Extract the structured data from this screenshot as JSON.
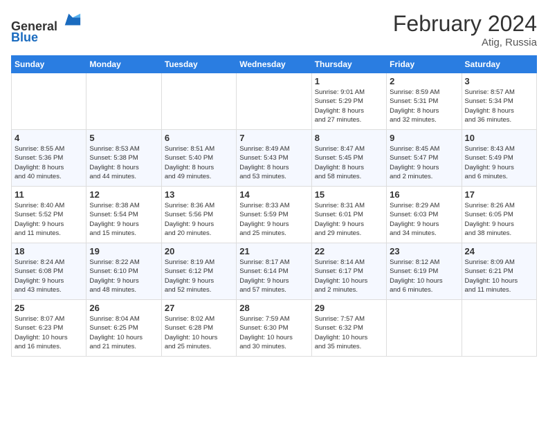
{
  "header": {
    "logo_line1": "General",
    "logo_line2": "Blue",
    "month_title": "February 2024",
    "location": "Atig, Russia"
  },
  "weekdays": [
    "Sunday",
    "Monday",
    "Tuesday",
    "Wednesday",
    "Thursday",
    "Friday",
    "Saturday"
  ],
  "weeks": [
    [
      {
        "day": "",
        "detail": ""
      },
      {
        "day": "",
        "detail": ""
      },
      {
        "day": "",
        "detail": ""
      },
      {
        "day": "",
        "detail": ""
      },
      {
        "day": "1",
        "detail": "Sunrise: 9:01 AM\nSunset: 5:29 PM\nDaylight: 8 hours\nand 27 minutes."
      },
      {
        "day": "2",
        "detail": "Sunrise: 8:59 AM\nSunset: 5:31 PM\nDaylight: 8 hours\nand 32 minutes."
      },
      {
        "day": "3",
        "detail": "Sunrise: 8:57 AM\nSunset: 5:34 PM\nDaylight: 8 hours\nand 36 minutes."
      }
    ],
    [
      {
        "day": "4",
        "detail": "Sunrise: 8:55 AM\nSunset: 5:36 PM\nDaylight: 8 hours\nand 40 minutes."
      },
      {
        "day": "5",
        "detail": "Sunrise: 8:53 AM\nSunset: 5:38 PM\nDaylight: 8 hours\nand 44 minutes."
      },
      {
        "day": "6",
        "detail": "Sunrise: 8:51 AM\nSunset: 5:40 PM\nDaylight: 8 hours\nand 49 minutes."
      },
      {
        "day": "7",
        "detail": "Sunrise: 8:49 AM\nSunset: 5:43 PM\nDaylight: 8 hours\nand 53 minutes."
      },
      {
        "day": "8",
        "detail": "Sunrise: 8:47 AM\nSunset: 5:45 PM\nDaylight: 8 hours\nand 58 minutes."
      },
      {
        "day": "9",
        "detail": "Sunrise: 8:45 AM\nSunset: 5:47 PM\nDaylight: 9 hours\nand 2 minutes."
      },
      {
        "day": "10",
        "detail": "Sunrise: 8:43 AM\nSunset: 5:49 PM\nDaylight: 9 hours\nand 6 minutes."
      }
    ],
    [
      {
        "day": "11",
        "detail": "Sunrise: 8:40 AM\nSunset: 5:52 PM\nDaylight: 9 hours\nand 11 minutes."
      },
      {
        "day": "12",
        "detail": "Sunrise: 8:38 AM\nSunset: 5:54 PM\nDaylight: 9 hours\nand 15 minutes."
      },
      {
        "day": "13",
        "detail": "Sunrise: 8:36 AM\nSunset: 5:56 PM\nDaylight: 9 hours\nand 20 minutes."
      },
      {
        "day": "14",
        "detail": "Sunrise: 8:33 AM\nSunset: 5:59 PM\nDaylight: 9 hours\nand 25 minutes."
      },
      {
        "day": "15",
        "detail": "Sunrise: 8:31 AM\nSunset: 6:01 PM\nDaylight: 9 hours\nand 29 minutes."
      },
      {
        "day": "16",
        "detail": "Sunrise: 8:29 AM\nSunset: 6:03 PM\nDaylight: 9 hours\nand 34 minutes."
      },
      {
        "day": "17",
        "detail": "Sunrise: 8:26 AM\nSunset: 6:05 PM\nDaylight: 9 hours\nand 38 minutes."
      }
    ],
    [
      {
        "day": "18",
        "detail": "Sunrise: 8:24 AM\nSunset: 6:08 PM\nDaylight: 9 hours\nand 43 minutes."
      },
      {
        "day": "19",
        "detail": "Sunrise: 8:22 AM\nSunset: 6:10 PM\nDaylight: 9 hours\nand 48 minutes."
      },
      {
        "day": "20",
        "detail": "Sunrise: 8:19 AM\nSunset: 6:12 PM\nDaylight: 9 hours\nand 52 minutes."
      },
      {
        "day": "21",
        "detail": "Sunrise: 8:17 AM\nSunset: 6:14 PM\nDaylight: 9 hours\nand 57 minutes."
      },
      {
        "day": "22",
        "detail": "Sunrise: 8:14 AM\nSunset: 6:17 PM\nDaylight: 10 hours\nand 2 minutes."
      },
      {
        "day": "23",
        "detail": "Sunrise: 8:12 AM\nSunset: 6:19 PM\nDaylight: 10 hours\nand 6 minutes."
      },
      {
        "day": "24",
        "detail": "Sunrise: 8:09 AM\nSunset: 6:21 PM\nDaylight: 10 hours\nand 11 minutes."
      }
    ],
    [
      {
        "day": "25",
        "detail": "Sunrise: 8:07 AM\nSunset: 6:23 PM\nDaylight: 10 hours\nand 16 minutes."
      },
      {
        "day": "26",
        "detail": "Sunrise: 8:04 AM\nSunset: 6:25 PM\nDaylight: 10 hours\nand 21 minutes."
      },
      {
        "day": "27",
        "detail": "Sunrise: 8:02 AM\nSunset: 6:28 PM\nDaylight: 10 hours\nand 25 minutes."
      },
      {
        "day": "28",
        "detail": "Sunrise: 7:59 AM\nSunset: 6:30 PM\nDaylight: 10 hours\nand 30 minutes."
      },
      {
        "day": "29",
        "detail": "Sunrise: 7:57 AM\nSunset: 6:32 PM\nDaylight: 10 hours\nand 35 minutes."
      },
      {
        "day": "",
        "detail": ""
      },
      {
        "day": "",
        "detail": ""
      }
    ]
  ]
}
